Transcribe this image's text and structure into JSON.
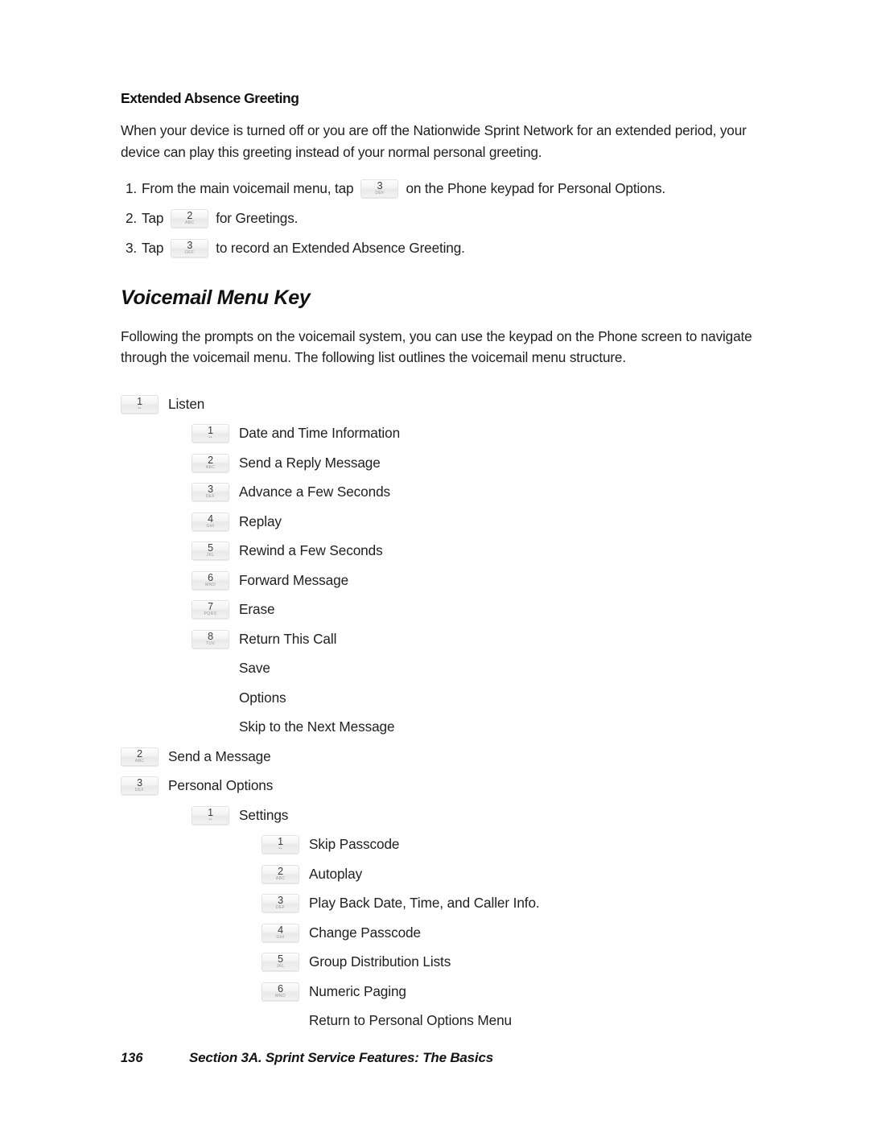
{
  "document": {
    "subheading": "Extended Absence Greeting",
    "intro_paragraph": "When your device is turned off or you are off the Nationwide Sprint Network for an extended period, your device can play this greeting instead of your normal personal greeting.",
    "steps": [
      {
        "number": "1.",
        "text_before": "From the main voicemail menu, tap",
        "key": {
          "digit": "3",
          "letters": "DEF"
        },
        "text_after": "on the Phone keypad for Personal Options."
      },
      {
        "number": "2.",
        "text_before": "Tap",
        "key": {
          "digit": "2",
          "letters": "ABC"
        },
        "text_after": "for Greetings."
      },
      {
        "number": "3.",
        "text_before": "Tap",
        "key": {
          "digit": "3",
          "letters": "DEF"
        },
        "text_after": "to record an Extended Absence Greeting."
      }
    ],
    "heading": "Voicemail Menu Key",
    "heading_paragraph": "Following the prompts on the voicemail system, you can use the keypad on the Phone screen to navigate through the voicemail menu. The following list outlines the voicemail menu structure.",
    "menu_tree": [
      {
        "level": 1,
        "key": {
          "digit": "1",
          "letters": "••"
        },
        "label": "Listen"
      },
      {
        "level": 2,
        "key": {
          "digit": "1",
          "letters": "••"
        },
        "label": "Date and Time Information"
      },
      {
        "level": 2,
        "key": {
          "digit": "2",
          "letters": "ABC"
        },
        "label": "Send a Reply Message"
      },
      {
        "level": 2,
        "key": {
          "digit": "3",
          "letters": "DEF"
        },
        "label": "Advance a Few Seconds"
      },
      {
        "level": 2,
        "key": {
          "digit": "4",
          "letters": "GHI"
        },
        "label": "Replay"
      },
      {
        "level": 2,
        "key": {
          "digit": "5",
          "letters": "JKL"
        },
        "label": "Rewind a Few Seconds"
      },
      {
        "level": 2,
        "key": {
          "digit": "6",
          "letters": "MNO"
        },
        "label": "Forward Message"
      },
      {
        "level": 2,
        "key": {
          "digit": "7",
          "letters": "PQRS"
        },
        "label": "Erase"
      },
      {
        "level": 2,
        "key": {
          "digit": "8",
          "letters": "TUV"
        },
        "label": "Return This Call"
      },
      {
        "level": 2,
        "key": null,
        "label": "Save"
      },
      {
        "level": 2,
        "key": null,
        "label": "Options"
      },
      {
        "level": 2,
        "key": null,
        "label": "Skip to the Next Message"
      },
      {
        "level": 1,
        "key": {
          "digit": "2",
          "letters": "ABC"
        },
        "label": "Send a Message"
      },
      {
        "level": 1,
        "key": {
          "digit": "3",
          "letters": "DEF"
        },
        "label": "Personal Options"
      },
      {
        "level": 2,
        "key": {
          "digit": "1",
          "letters": "••"
        },
        "label": "Settings"
      },
      {
        "level": 3,
        "key": {
          "digit": "1",
          "letters": "••"
        },
        "label": "Skip Passcode"
      },
      {
        "level": 3,
        "key": {
          "digit": "2",
          "letters": "ABC"
        },
        "label": "Autoplay"
      },
      {
        "level": 3,
        "key": {
          "digit": "3",
          "letters": "DEF"
        },
        "label": "Play Back Date, Time, and Caller Info."
      },
      {
        "level": 3,
        "key": {
          "digit": "4",
          "letters": "GHI"
        },
        "label": "Change Passcode"
      },
      {
        "level": 3,
        "key": {
          "digit": "5",
          "letters": "JKL"
        },
        "label": "Group Distribution Lists"
      },
      {
        "level": 3,
        "key": {
          "digit": "6",
          "letters": "MNO"
        },
        "label": "Numeric Paging"
      },
      {
        "level": 3,
        "key": null,
        "label": "Return to Personal Options Menu"
      }
    ],
    "footer": {
      "page_number": "136",
      "section_title": "Section 3A. Sprint Service Features: The Basics"
    },
    "colors": {
      "text": "#212121",
      "heading": "#111111",
      "key_face": "#f4f4f4",
      "key_border": "#e2e2e2",
      "key_letters": "#9a9a9a",
      "background": "#ffffff"
    }
  }
}
